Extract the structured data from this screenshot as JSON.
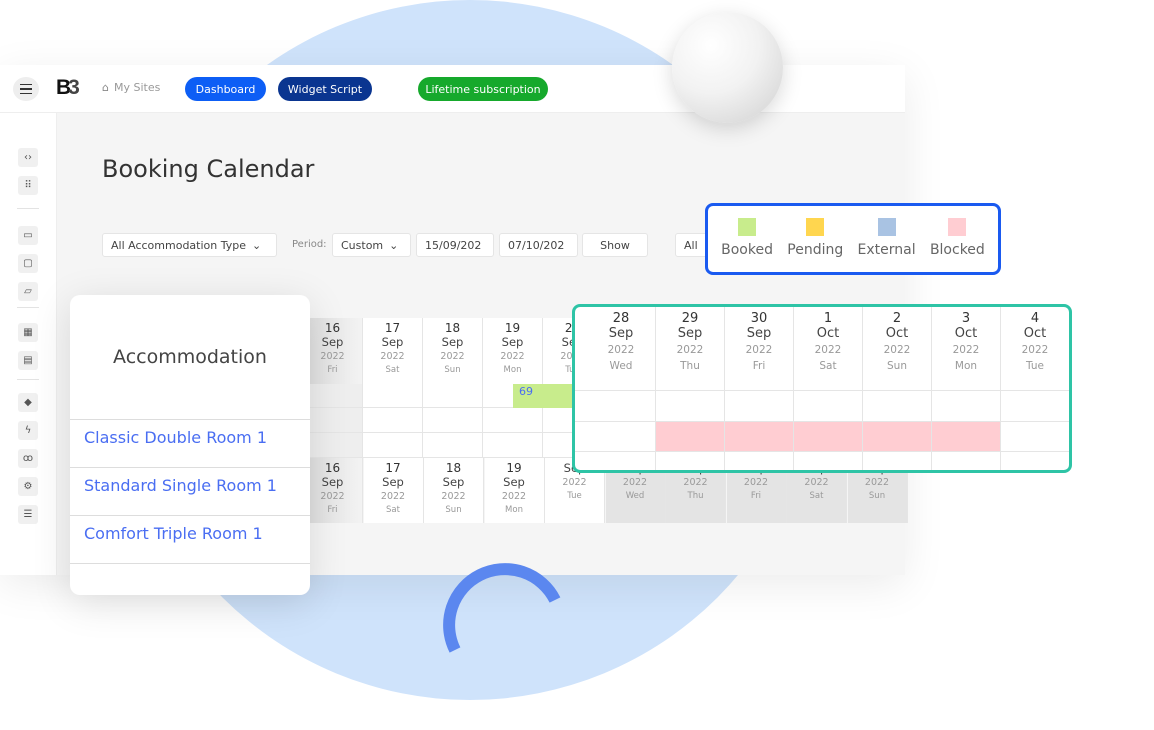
{
  "header": {
    "my_sites": "My Sites",
    "dashboard": "Dashboard",
    "widget_script": "Widget Script",
    "lifetime": "Lifetime subscription",
    "logo": "B3"
  },
  "colors": {
    "dashboard": "#0d5ef5",
    "widget": "#0a3590",
    "lifetime": "#16a92c",
    "booked": "#c8ec8c",
    "pending": "#ffd64f",
    "external": "#a9c3e3",
    "blocked": "#ffcdd2"
  },
  "page": {
    "title": "Booking Calendar"
  },
  "filters": {
    "type": "All Accommodation Type",
    "period_label": "Period:",
    "period": "Custom",
    "from": "15/09/202",
    "to": "07/10/202",
    "show": "Show",
    "all": "All"
  },
  "legend": [
    "Booked",
    "Pending",
    "External",
    "Blocked"
  ],
  "accommodation": {
    "header": "Accommodation",
    "rooms": [
      "Classic Double Room 1",
      "Standard Single Room 1",
      "Comfort Triple Room 1"
    ]
  },
  "calendar_top": [
    {
      "d": "16",
      "m": "Sep",
      "y": "2022",
      "w": "Fri"
    },
    {
      "d": "17",
      "m": "Sep",
      "y": "2022",
      "w": "Sat"
    },
    {
      "d": "18",
      "m": "Sep",
      "y": "2022",
      "w": "Sun"
    },
    {
      "d": "19",
      "m": "Sep",
      "y": "2022",
      "w": "Mon"
    },
    {
      "d": "20",
      "m": "Sep",
      "y": "2022",
      "w": "Tue"
    }
  ],
  "booking_label": "69",
  "calendar_bottom": [
    {
      "d": "16",
      "m": "Sep",
      "y": "2022",
      "w": "Fri"
    },
    {
      "d": "17",
      "m": "Sep",
      "y": "2022",
      "w": "Sat"
    },
    {
      "d": "18",
      "m": "Sep",
      "y": "2022",
      "w": "Sun"
    },
    {
      "d": "19",
      "m": "Sep",
      "y": "2022",
      "w": "Mon"
    },
    {
      "d": "",
      "m": "Sep",
      "y": "2022",
      "w": "Tue"
    },
    {
      "d": "",
      "m": "Sep",
      "y": "2022",
      "w": "Wed"
    },
    {
      "d": "",
      "m": "Sep",
      "y": "2022",
      "w": "Thu"
    },
    {
      "d": "",
      "m": "Sep",
      "y": "2022",
      "w": "Fri"
    },
    {
      "d": "",
      "m": "Sep",
      "y": "2022",
      "w": "Sat"
    },
    {
      "d": "",
      "m": "Sep",
      "y": "2022",
      "w": "Sun"
    }
  ],
  "zoom_calendar": [
    {
      "d": "28",
      "m": "Sep",
      "y": "2022",
      "w": "Wed"
    },
    {
      "d": "29",
      "m": "Sep",
      "y": "2022",
      "w": "Thu"
    },
    {
      "d": "30",
      "m": "Sep",
      "y": "2022",
      "w": "Fri"
    },
    {
      "d": "1",
      "m": "Oct",
      "y": "2022",
      "w": "Sat"
    },
    {
      "d": "2",
      "m": "Oct",
      "y": "2022",
      "w": "Sun"
    },
    {
      "d": "3",
      "m": "Oct",
      "y": "2022",
      "w": "Mon"
    },
    {
      "d": "4",
      "m": "Oct",
      "y": "2022",
      "w": "Tue"
    }
  ],
  "sidebar_icons": [
    "code-icon",
    "grid-icon",
    "image-icon",
    "layers-icon",
    "comment-icon",
    "building-icon",
    "calendar-icon",
    "paint-bucket-icon",
    "lightning-icon",
    "users-icon",
    "gear-icon",
    "sliders-icon"
  ]
}
